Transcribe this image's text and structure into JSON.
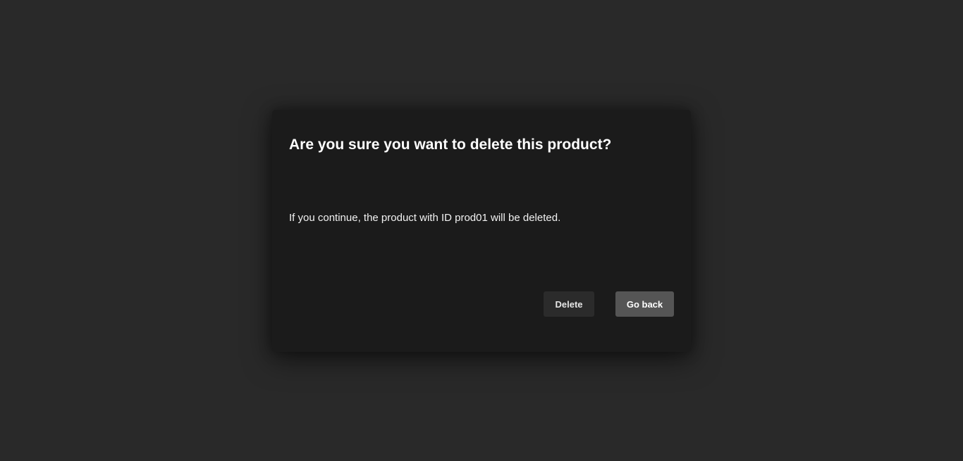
{
  "dialog": {
    "title": "Are you sure you want to delete this product?",
    "message": "If you continue, the product with ID prod01 will be deleted.",
    "delete_label": "Delete",
    "go_back_label": "Go back"
  },
  "colors": {
    "backdrop": "#292929",
    "dialog_bg": "#1b1b1b",
    "delete_button_bg": "#2b2b2b",
    "go_back_button_bg": "#555555",
    "text": "#ffffff"
  }
}
